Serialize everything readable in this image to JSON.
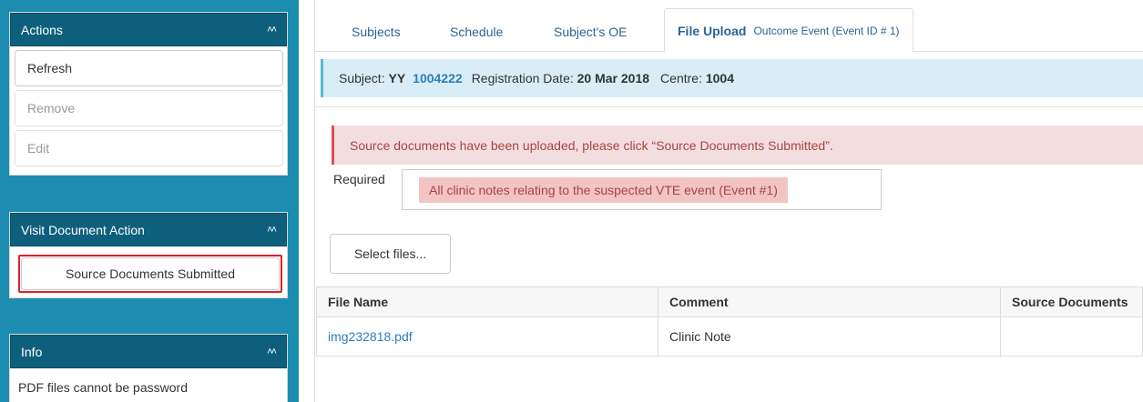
{
  "actions_panel": {
    "title": "Actions",
    "buttons": [
      {
        "label": "Refresh",
        "enabled": true
      },
      {
        "label": "Remove",
        "enabled": false
      },
      {
        "label": "Edit",
        "enabled": false
      }
    ]
  },
  "visit_panel": {
    "title": "Visit Document Action",
    "button_label": "Source Documents Submitted"
  },
  "info_panel": {
    "title": "Info",
    "text": "PDF files cannot be password"
  },
  "tabs": [
    {
      "label": "Subjects"
    },
    {
      "label": "Schedule"
    },
    {
      "label": "Subject's OE"
    },
    {
      "label": "File Upload",
      "sub": "Outcome Event (Event ID # 1)",
      "active": true
    }
  ],
  "subject_bar": {
    "subject_label": "Subject:",
    "subject_initials": "YY",
    "subject_id": "1004222",
    "reg_label": "Registration Date:",
    "reg_date": "20 Mar 2018",
    "centre_label": "Centre:",
    "centre": "1004"
  },
  "alert": {
    "text": "Source documents have been uploaded, please click “Source Documents Submitted”."
  },
  "required": {
    "label": "Required",
    "item": "All clinic notes relating to the suspected VTE event (Event #1)"
  },
  "select_files_label": "Select files...",
  "table": {
    "headers": [
      "File Name",
      "Comment",
      "Source Documents"
    ],
    "rows": [
      {
        "file_name": "img232818.pdf",
        "comment": "Clinic Note",
        "source_documents": ""
      }
    ]
  },
  "colors": {
    "rail": "#1c8db1",
    "panel_header": "#0e5f7c",
    "link": "#2a7fba",
    "info_bg": "#d9edf7",
    "alert_bg": "#f2dede",
    "highlight": "#d9232e"
  }
}
